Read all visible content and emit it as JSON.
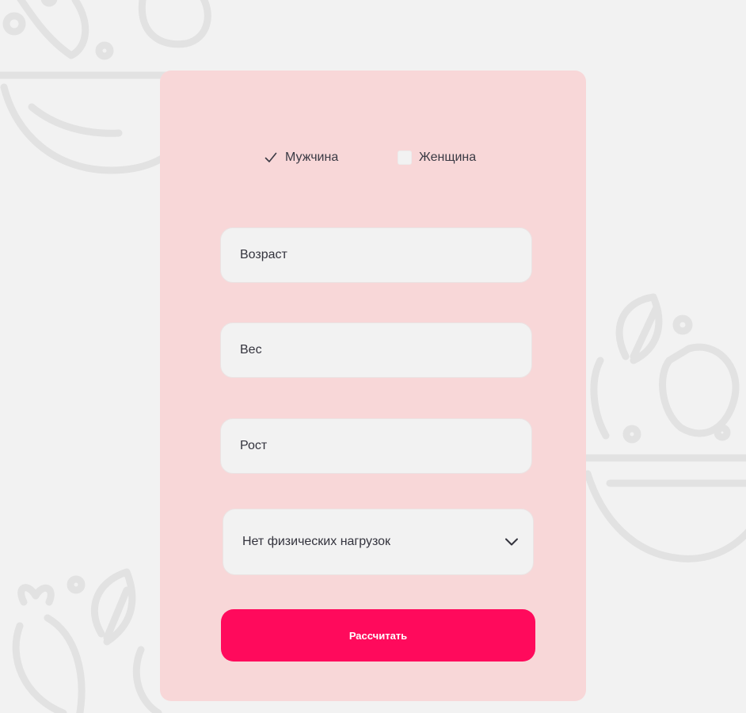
{
  "colors": {
    "page_background": "#f2f2f2",
    "card_background": "#f8d7d8",
    "field_background": "#f2f2f2",
    "accent": "#ff0a5c",
    "text": "#33333d"
  },
  "gender": {
    "male_label": "Мужчина",
    "male_checked": true,
    "female_label": "Женщина",
    "female_checked": false
  },
  "fields": {
    "age_placeholder": "Возраст",
    "weight_placeholder": "Вес",
    "height_placeholder": "Рост"
  },
  "activity_select": {
    "selected": "Нет физических нагрузок",
    "icon": "chevron-down-icon"
  },
  "submit_label": "Рассчитать",
  "background_icons": [
    "carrot-icon",
    "salad-bowl-icon",
    "leaf-icon",
    "lemon-icon",
    "radish-icon"
  ]
}
